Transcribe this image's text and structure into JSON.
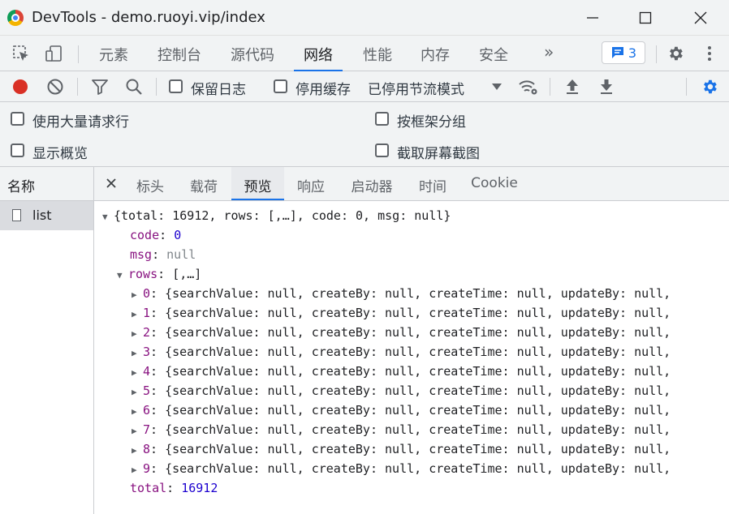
{
  "window": {
    "title": "DevTools - demo.ruoyi.vip/index"
  },
  "main_tabs": [
    {
      "label": "元素"
    },
    {
      "label": "控制台"
    },
    {
      "label": "源代码"
    },
    {
      "label": "网络"
    },
    {
      "label": "性能"
    },
    {
      "label": "内存"
    },
    {
      "label": "安全"
    }
  ],
  "more_tabs_glyph": "»",
  "message_count": "3",
  "toolbar": {
    "preserve_log": "保留日志",
    "disable_cache": "停用缓存",
    "throttling": "已停用节流模式"
  },
  "settings": {
    "large_rows": "使用大量请求行",
    "group_by_frame": "按框架分组",
    "show_overview": "显示概览",
    "capture_screenshots": "截取屏幕截图"
  },
  "left_panel": {
    "header": "名称",
    "requests": [
      {
        "name": "list"
      }
    ]
  },
  "detail_tabs": [
    {
      "label": "标头"
    },
    {
      "label": "载荷"
    },
    {
      "label": "预览"
    },
    {
      "label": "响应"
    },
    {
      "label": "启动器"
    },
    {
      "label": "时间"
    },
    {
      "label": "Cookie"
    }
  ],
  "preview": {
    "summary": "{total: 16912, rows: [,…], code: 0, msg: null}",
    "code_key": "code",
    "code_val": "0",
    "msg_key": "msg",
    "msg_val": "null",
    "rows_key": "rows",
    "rows_summary": "[,…]",
    "row_text": "{searchValue: null, createBy: null, createTime: null, updateBy: null,",
    "row_indices": [
      "0",
      "1",
      "2",
      "3",
      "4",
      "5",
      "6",
      "7",
      "8",
      "9"
    ],
    "total_key": "total",
    "total_val": "16912"
  },
  "colors": {
    "accent": "#1a73e8",
    "record": "#d93025",
    "json_key": "#881280",
    "json_number": "#1c00cf"
  }
}
